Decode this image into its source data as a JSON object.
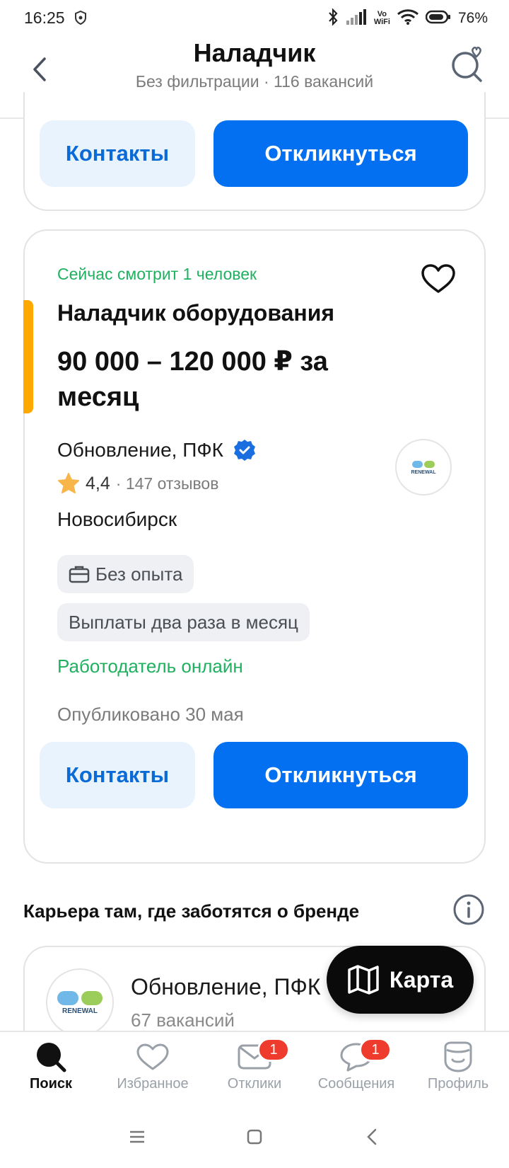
{
  "status_bar": {
    "time": "16:25",
    "vowifi_top": "Vo",
    "vowifi_bottom": "WiFi",
    "battery_percent": "76%"
  },
  "header": {
    "title": "Наладчик",
    "subtitle": "Без фильтрации · 116 вакансий",
    "back_icon": "chevron-left-icon",
    "saved_search_icon": "search-heart-icon"
  },
  "previous_card": {
    "contacts_label": "Контакты",
    "apply_label": "Откликнуться"
  },
  "vacancy": {
    "viewing_now": "Сейчас смотрит 1 человек",
    "title": "Наладчик оборудования",
    "salary": "90 000 – 120 000 ₽ за месяц",
    "company": "Обновление, ПФК",
    "rating": "4,4",
    "reviews": "· 147 отзывов",
    "city": "Новосибирск",
    "chips": [
      "Без опыта",
      "Выплаты два раза в месяц"
    ],
    "employer_online": "Работодатель онлайн",
    "published": "Опубликовано 30 мая",
    "contacts_label": "Контакты",
    "apply_label": "Откликнуться",
    "logo_text": "RENEWAL",
    "accent_color": "#ffa800"
  },
  "brand_section": {
    "title": "Карьера там, где заботятся о бренде",
    "company_name": "Обновление, ПФК",
    "vacancies": "67 вакансий",
    "logo_text": "RENEWAL"
  },
  "map_button": {
    "label": "Карта",
    "icon": "map-icon"
  },
  "bottom_nav": {
    "items": [
      {
        "label": "Поиск",
        "icon": "search-icon",
        "active": true
      },
      {
        "label": "Избранное",
        "icon": "heart-icon"
      },
      {
        "label": "Отклики",
        "icon": "envelope-icon",
        "badge": "1"
      },
      {
        "label": "Сообщения",
        "icon": "chat-icon",
        "badge": "1"
      },
      {
        "label": "Профиль",
        "icon": "profile-icon"
      }
    ]
  },
  "colors": {
    "primary": "#0270f0",
    "contacts_bg": "#e9f3fe",
    "green": "#1fb060",
    "badge": "#ef3b2d"
  }
}
